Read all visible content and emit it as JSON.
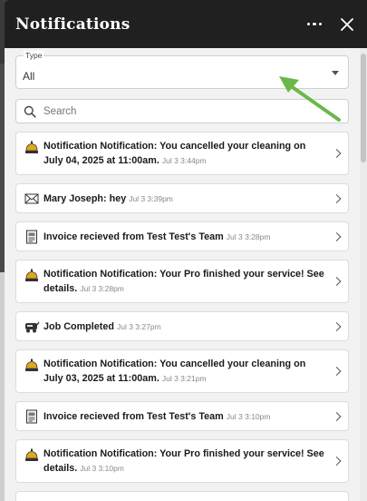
{
  "header": {
    "title": "Notifications"
  },
  "filter": {
    "label": "Type",
    "value": "All"
  },
  "search": {
    "placeholder": "Search"
  },
  "notifications": [
    {
      "icon": "bell-icon",
      "message": "Notification Notification: You cancelled your cleaning on July 04, 2025 at 11:00am.",
      "time": "Jul 3 3:44pm"
    },
    {
      "icon": "envelope-icon",
      "message": "Mary Joseph: hey",
      "time": "Jul 3 3:39pm"
    },
    {
      "icon": "invoice-icon",
      "message": "Invoice recieved from Test Test's Team",
      "time": "Jul 3 3:28pm"
    },
    {
      "icon": "bell-icon",
      "message": "Notification Notification: Your Pro finished your service! See details.",
      "time": "Jul 3 3:28pm"
    },
    {
      "icon": "vacuum-icon",
      "message": "Job Completed",
      "time": "Jul 3 3:27pm"
    },
    {
      "icon": "bell-icon",
      "message": "Notification Notification: You cancelled your cleaning on July 03, 2025 at 11:00am.",
      "time": "Jul 3 3:21pm"
    },
    {
      "icon": "invoice-icon",
      "message": "Invoice recieved from Test Test's Team",
      "time": "Jul 3 3:10pm"
    },
    {
      "icon": "bell-icon",
      "message": "Notification Notification: Your Pro finished your service! See details.",
      "time": "Jul 3 3:10pm"
    }
  ],
  "colors": {
    "header_bg": "#202020",
    "panel_bg": "#f2f2f2",
    "annotation_arrow": "#6ab84a"
  }
}
